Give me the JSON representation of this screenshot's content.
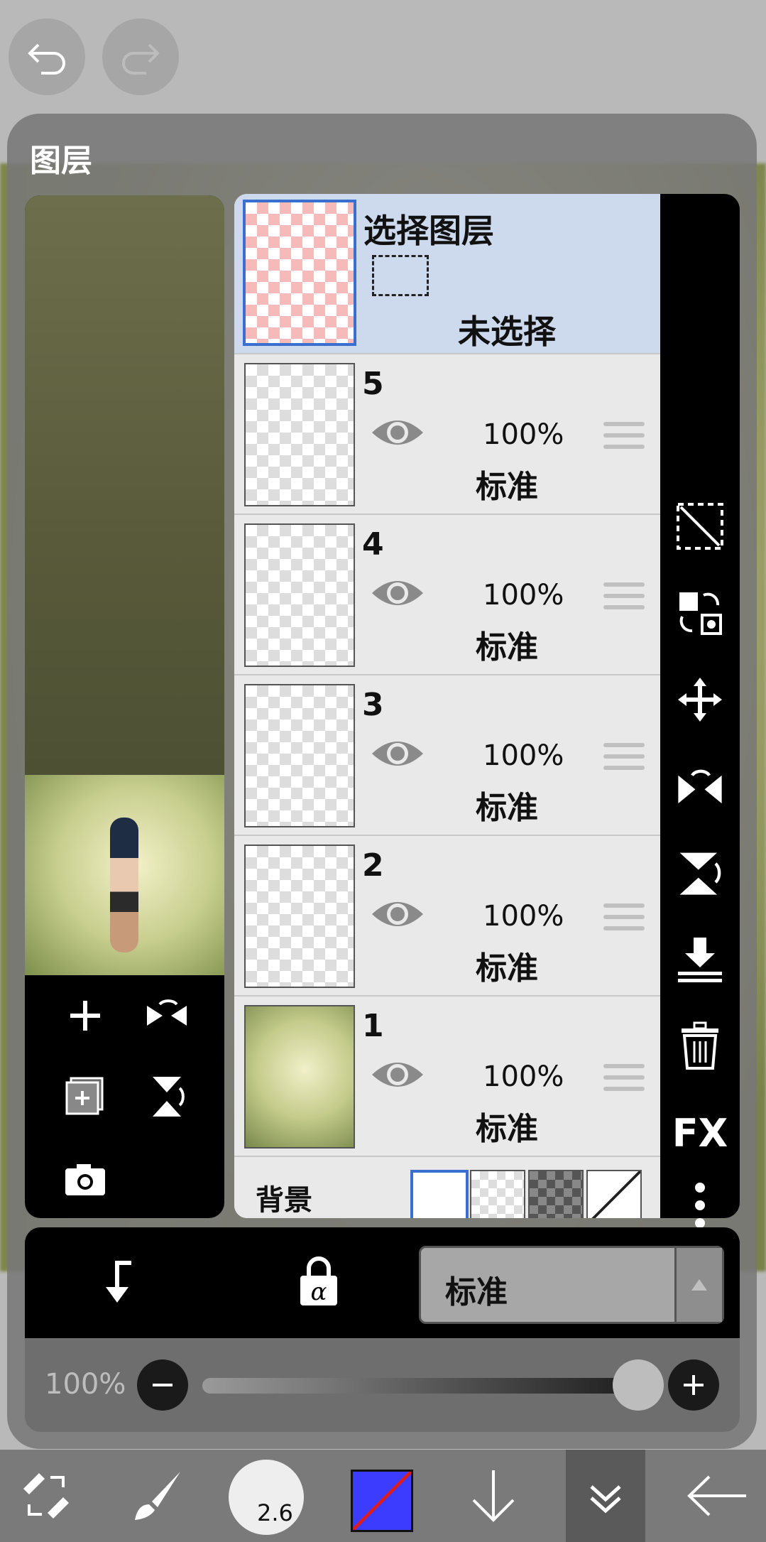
{
  "panel": {
    "title": "图层"
  },
  "selection_layer": {
    "title": "选择图层",
    "status": "未选择"
  },
  "layers": [
    {
      "number": "5",
      "opacity": "100%",
      "mode": "标准"
    },
    {
      "number": "4",
      "opacity": "100%",
      "mode": "标准"
    },
    {
      "number": "3",
      "opacity": "100%",
      "mode": "标准"
    },
    {
      "number": "2",
      "opacity": "100%",
      "mode": "标准"
    },
    {
      "number": "1",
      "opacity": "100%",
      "mode": "标准"
    }
  ],
  "background": {
    "label": "背景"
  },
  "blend": {
    "mode": "标准"
  },
  "opacity_slider": {
    "label": "100%",
    "value_percent": 100
  },
  "toolbar": {
    "fx_label": "FX"
  },
  "bottom": {
    "brush_size": "2.6",
    "color": "#3c3cff"
  }
}
